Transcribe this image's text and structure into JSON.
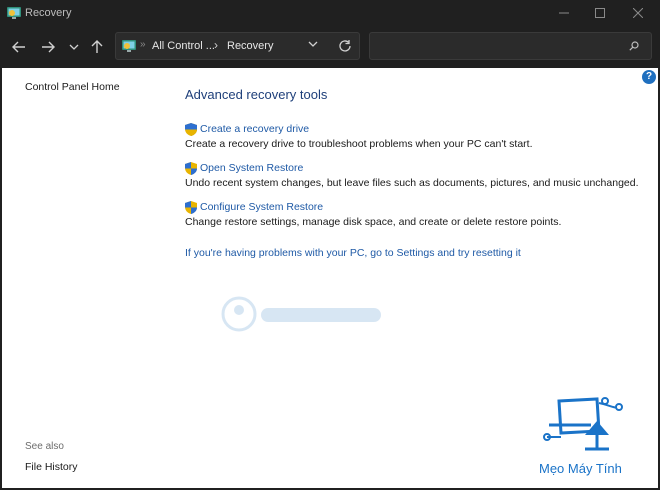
{
  "window": {
    "title": "Recovery",
    "controls": {
      "minimize": "minimize",
      "maximize": "maximize",
      "close": "close"
    }
  },
  "nav": {
    "address": {
      "crumb1": "All Control ...",
      "separator": "›",
      "crumb2": "Recovery"
    },
    "search": {
      "value": "",
      "placeholder": ""
    }
  },
  "left_pane": {
    "home_link": "Control Panel Home",
    "see_also": "See also",
    "file_history": "File History"
  },
  "help": {
    "label": "?"
  },
  "main": {
    "section_title": "Advanced recovery tools",
    "tools": [
      {
        "link": "Create a recovery drive",
        "desc": "Create a recovery drive to troubleshoot problems when your PC can't start."
      },
      {
        "link": "Open System Restore",
        "desc": "Undo recent system changes, but leave files such as documents, pictures, and music unchanged."
      },
      {
        "link": "Configure System Restore",
        "desc": "Change restore settings, manage disk space, and create or delete restore points."
      }
    ],
    "reset_link": "If you're having problems with your PC, go to Settings and try resetting it"
  },
  "watermark": {
    "text": "Mẹo Máy Tính"
  },
  "colors": {
    "accent": "#1f5aa6",
    "titlebar": "#202020",
    "content_bg": "#ffffff",
    "heading": "#1e3f7a"
  }
}
